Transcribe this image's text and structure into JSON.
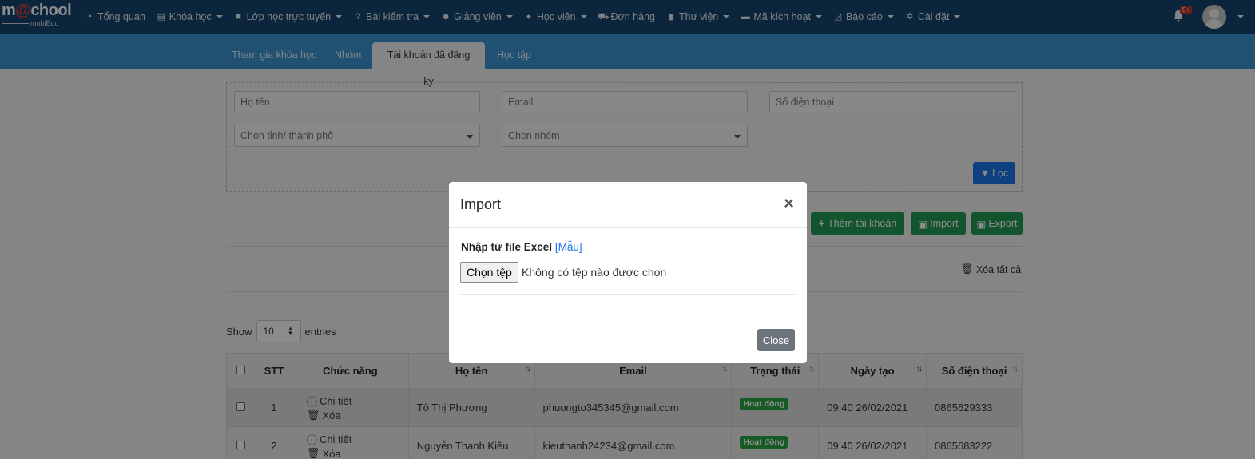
{
  "brand": {
    "logo_main": "m",
    "logo_o": "@",
    "logo_rest": "chool",
    "logo_sub": "mobiEdu"
  },
  "nav": {
    "items": [
      {
        "label": "Tổng quan",
        "icon": "dashboard-icon",
        "caret": false
      },
      {
        "label": "Khóa học",
        "icon": "list-icon",
        "caret": true
      },
      {
        "label": "Lớp học trực tuyến",
        "icon": "video-icon",
        "caret": true
      },
      {
        "label": "Bài kiểm tra",
        "icon": "question-icon",
        "caret": true
      },
      {
        "label": "Giảng viên",
        "icon": "users-icon",
        "caret": true
      },
      {
        "label": "Học viên",
        "icon": "user-icon",
        "caret": true
      },
      {
        "label": "Đơn hàng",
        "icon": "cart-icon",
        "caret": false
      },
      {
        "label": "Thư viện",
        "icon": "book-icon",
        "caret": true
      },
      {
        "label": "Mã kích hoạt",
        "icon": "card-icon",
        "caret": true
      },
      {
        "label": "Báo cáo",
        "icon": "chart-icon",
        "caret": true
      },
      {
        "label": "Cài đặt",
        "icon": "gears-icon",
        "caret": true
      }
    ],
    "notification_count": "9+"
  },
  "tabs": [
    {
      "label": "Tham gia khóa học",
      "active": false
    },
    {
      "label": "Nhóm",
      "active": false
    },
    {
      "label": "Tài khoản đã đăng ký",
      "active": true
    },
    {
      "label": "Học tập",
      "active": false
    }
  ],
  "filter": {
    "name_placeholder": "Họ tên",
    "email_placeholder": "Email",
    "phone_placeholder": "Số điện thoại",
    "province_select": "Chọn tỉnh/ thành phố",
    "group_select": "Chọn nhóm",
    "filter_button": "Lọc"
  },
  "actions": {
    "add_account": "Thêm tài khoản",
    "import": "Import",
    "export": "Export",
    "delete_all": "Xóa tất cả"
  },
  "entries": {
    "show": "Show",
    "value": "10",
    "suffix": "entries"
  },
  "table": {
    "headers": [
      "STT",
      "Chức năng",
      "Họ tên",
      "Email",
      "Trạng thái",
      "Ngày tạo",
      "Số điện thoại"
    ],
    "detail_label": "Chi tiết",
    "delete_label": "Xóa",
    "rows": [
      {
        "stt": "1",
        "name": "Tô Thị Phương",
        "email": "phuongto345345@gmail.com",
        "status": "Hoạt động",
        "created": "09:40 26/02/2021",
        "phone": "0865629333"
      },
      {
        "stt": "2",
        "name": "Nguyễn Thanh Kiều",
        "email": "kieuthanh24234@gmail.com",
        "status": "Hoạt động",
        "created": "09:40 26/02/2021",
        "phone": "0865683222"
      }
    ]
  },
  "modal": {
    "title": "Import",
    "close_symbol": "×",
    "label": "Nhập từ file Excel",
    "template_link": "Mẫu",
    "file_button": "Chọn tệp",
    "file_status": "Không có tệp nào được chọn",
    "close_button": "Close"
  }
}
